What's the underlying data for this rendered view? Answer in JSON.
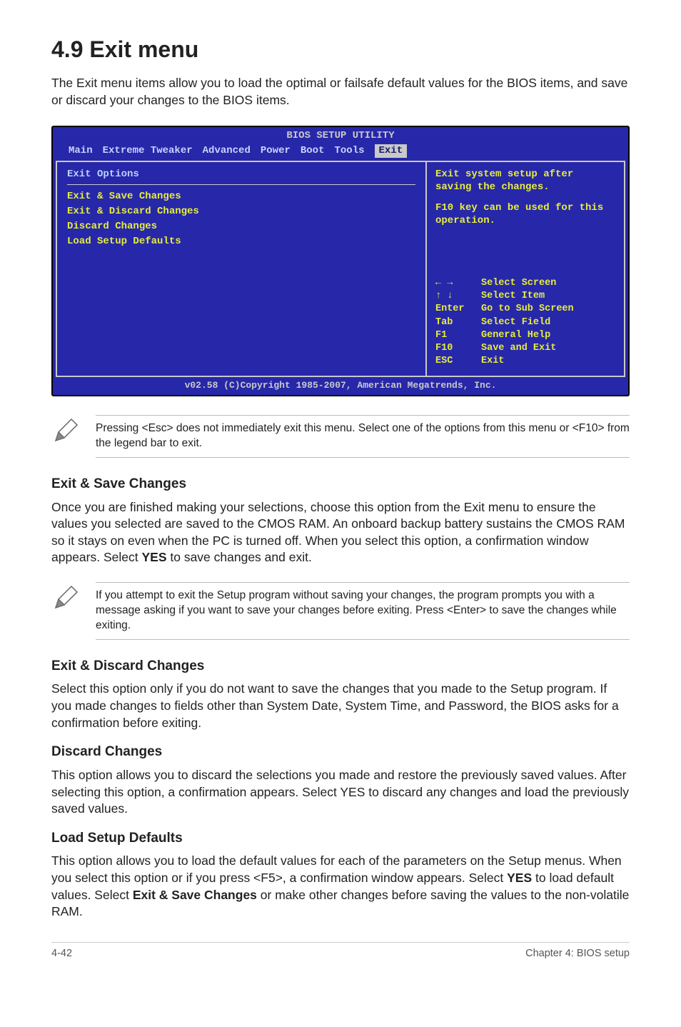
{
  "section": {
    "number_title": "4.9    Exit menu",
    "intro": "The Exit menu items allow you to load the optimal or failsafe default values for the BIOS items, and save or discard your changes to the BIOS items."
  },
  "bios": {
    "top_label": "BIOS SETUP UTILITY",
    "tabs": {
      "main": "Main",
      "extreme": "Extreme Tweaker",
      "advanced": "Advanced",
      "power": "Power",
      "boot": "Boot",
      "tools": "Tools",
      "exit": "Exit"
    },
    "left": {
      "heading": "Exit Options",
      "items": [
        "Exit & Save Changes",
        "Exit & Discard Changes",
        "Discard Changes",
        "",
        "Load Setup Defaults"
      ]
    },
    "right": {
      "help1": "Exit system setup after saving the changes.",
      "help2": "F10 key can be used for this operation.",
      "legend": [
        {
          "key": "← →",
          "label": "Select Screen"
        },
        {
          "key": "↑ ↓",
          "label": "Select Item"
        },
        {
          "key": "Enter",
          "label": "Go to Sub Screen"
        },
        {
          "key": "Tab",
          "label": "Select Field"
        },
        {
          "key": "F1",
          "label": "General Help"
        },
        {
          "key": "F10",
          "label": "Save and Exit"
        },
        {
          "key": "ESC",
          "label": "Exit"
        }
      ]
    },
    "footer": "v02.58 (C)Copyright 1985-2007, American Megatrends, Inc."
  },
  "notes": {
    "esc_note": "Pressing <Esc> does not immediately exit this menu. Select one of the options from this menu or <F10> from the legend bar to exit.",
    "exit_no_save_note": " If you attempt to exit the Setup program without saving your changes, the program prompts you with a message asking if you want to save your changes before exiting. Press <Enter>  to save the  changes while exiting."
  },
  "subsections": {
    "exit_save": {
      "title": "Exit & Save Changes",
      "body_prefix": "Once you are finished making your selections, choose this option from the Exit menu to ensure the values you selected are saved to the CMOS RAM. An onboard backup battery sustains the CMOS RAM so it stays on even when the PC is turned off. When you select this option, a confirmation window appears. Select ",
      "yes": "YES",
      "body_suffix": " to save changes and exit."
    },
    "exit_discard": {
      "title": "Exit & Discard Changes",
      "body": "Select this option only if you do not want to save the changes that you  made to the Setup program. If you made changes to fields other than System Date, System Time, and Password, the BIOS asks for a confirmation before exiting."
    },
    "discard": {
      "title": "Discard Changes",
      "body": "This option allows you to discard the selections you made and restore the previously saved values. After selecting this option, a confirmation appears. Select YES to discard any changes and load the previously saved values."
    },
    "load_defaults": {
      "title": "Load Setup Defaults",
      "body_prefix": "This option allows you to load the default values for each of the parameters on the Setup menus. When you select this option or if you press <F5>, a confirmation window appears. Select ",
      "yes": "YES",
      "mid": " to load default values. Select ",
      "exit_save": "Exit & Save Changes",
      "body_suffix": " or make other changes before saving the values to the non-volatile RAM."
    }
  },
  "footer": {
    "page": "4-42",
    "chapter": "Chapter 4: BIOS setup"
  }
}
